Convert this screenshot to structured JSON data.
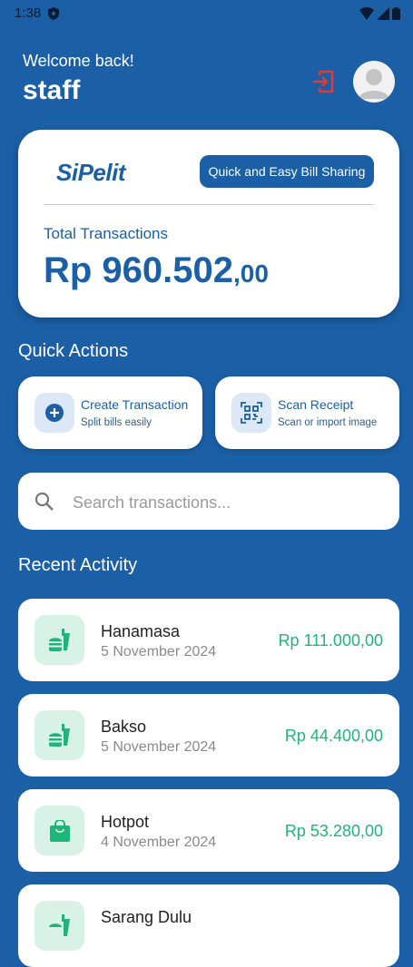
{
  "status": {
    "time": "1:38"
  },
  "header": {
    "welcome": "Welcome back!",
    "username": "staff"
  },
  "card": {
    "logo_text": "SiPelit",
    "tagline": "Quick and Easy Bill Sharing",
    "total_label": "Total Transactions",
    "total_amount_main": "Rp 960.502",
    "total_amount_cents": ",00"
  },
  "quick_actions": {
    "title": "Quick Actions",
    "items": [
      {
        "title": "Create Transaction",
        "subtitle": "Split bills easily",
        "icon": "plus-circle-icon"
      },
      {
        "title": "Scan Receipt",
        "subtitle": "Scan or import image",
        "icon": "qr-scan-icon"
      }
    ]
  },
  "search": {
    "placeholder": "Search transactions..."
  },
  "recent": {
    "title": "Recent Activity",
    "items": [
      {
        "name": "Hanamasa",
        "date": "5 November 2024",
        "amount": "Rp 111.000,00",
        "icon": "fastfood-icon"
      },
      {
        "name": "Bakso",
        "date": "5 November 2024",
        "amount": "Rp 44.400,00",
        "icon": "fastfood-icon"
      },
      {
        "name": "Hotpot",
        "date": "4 November 2024",
        "amount": "Rp 53.280,00",
        "icon": "shopping-bag-icon"
      },
      {
        "name": "Sarang Dulu",
        "date": "",
        "amount": "",
        "icon": "fastfood-icon"
      }
    ]
  },
  "colors": {
    "primary": "#1b5fa6",
    "accent_green": "#1fb57a",
    "logout_red": "#e53935"
  }
}
